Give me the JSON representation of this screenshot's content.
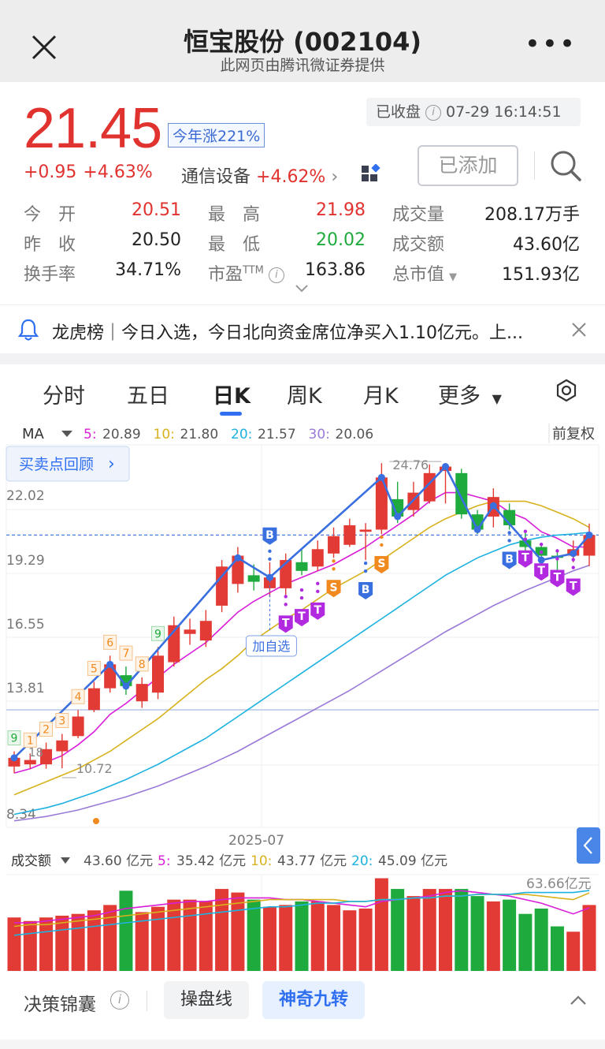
{
  "header": {
    "title": "恒宝股份 (002104)",
    "subtitle": "此网页由腾讯微证券提供",
    "more_label": "•••"
  },
  "quote": {
    "price": "21.45",
    "ytd_badge": "今年涨221%",
    "status": "已收盘",
    "timestamp": "07-29 16:14:51",
    "change": "+0.95",
    "change_pct": "+4.63%",
    "industry": "通信设备",
    "industry_pct": "+4.62%",
    "added_button": "已添加"
  },
  "stats": [
    [
      {
        "label": "今　开",
        "value": "20.51",
        "tone": "red"
      },
      {
        "label": "最　高",
        "value": "21.98",
        "tone": "red"
      },
      {
        "label": "成交量",
        "value": "208.17万手",
        "tone": "plain"
      }
    ],
    [
      {
        "label": "昨　收",
        "value": "20.50",
        "tone": "plain"
      },
      {
        "label": "最　低",
        "value": "20.02",
        "tone": "green"
      },
      {
        "label": "成交额",
        "value": "43.60亿",
        "tone": "plain"
      }
    ],
    [
      {
        "label": "换手率",
        "value": "34.71%",
        "tone": "plain"
      },
      {
        "label": "市盈TTM",
        "value": "163.86",
        "tone": "plain"
      },
      {
        "label": "总市值",
        "value": "151.93亿",
        "tone": "plain"
      }
    ]
  ],
  "notice": {
    "text": "龙虎榜｜今日入选，今日北向资金席位净买入1.10亿元。上..."
  },
  "tabs": [
    {
      "label": "分时",
      "active": false
    },
    {
      "label": "五日",
      "active": false
    },
    {
      "label": "日K",
      "active": true
    },
    {
      "label": "周K",
      "active": false
    },
    {
      "label": "月K",
      "active": false
    },
    {
      "label": "更多",
      "active": false
    }
  ],
  "ma_legend": {
    "label": "MA",
    "items": [
      {
        "name": "5:",
        "value": "20.89",
        "color": "#d81ed8"
      },
      {
        "name": "10:",
        "value": "21.80",
        "color": "#d8b21e"
      },
      {
        "name": "20:",
        "value": "21.57",
        "color": "#1eb2e0"
      },
      {
        "name": "30:",
        "value": "20.06",
        "color": "#9a7ad8"
      }
    ],
    "adjust": "前复权"
  },
  "review_button": "买卖点回顾",
  "add_watch_label": "加自选",
  "volume_legend": {
    "label": "成交额",
    "items": [
      {
        "name": "",
        "value": "43.60 亿元",
        "color": "#555555"
      },
      {
        "name": "5:",
        "value": "35.42 亿元",
        "color": "#d81ed8"
      },
      {
        "name": "10:",
        "value": "43.77 亿元",
        "color": "#d8b21e"
      },
      {
        "name": "20:",
        "value": "45.09 亿元",
        "color": "#1eb2e0"
      }
    ],
    "max_label": "63.66亿元"
  },
  "chart_data": {
    "type": "candlestick",
    "y_ticks": [
      "22.02",
      "19.29",
      "16.55",
      "13.81",
      "8.34"
    ],
    "x_tick": "2025-07",
    "high_label": "24.76",
    "low_label": "10.72",
    "partial_label": "18",
    "last_price": 21.45,
    "candles": [
      {
        "o": 10.8,
        "c": 11.2,
        "h": 11.5,
        "l": 10.5
      },
      {
        "o": 10.9,
        "c": 11.1,
        "h": 11.4,
        "l": 10.7
      },
      {
        "o": 10.9,
        "c": 11.6,
        "h": 11.9,
        "l": 10.7
      },
      {
        "o": 11.5,
        "c": 12.0,
        "h": 12.3,
        "l": 10.72
      },
      {
        "o": 12.2,
        "c": 13.1,
        "h": 13.4,
        "l": 12.1
      },
      {
        "o": 13.4,
        "c": 14.4,
        "h": 14.7,
        "l": 13.3
      },
      {
        "o": 14.4,
        "c": 15.5,
        "h": 15.9,
        "l": 14.2
      },
      {
        "o": 15.0,
        "c": 14.5,
        "h": 15.4,
        "l": 14.1
      },
      {
        "o": 13.8,
        "c": 14.6,
        "h": 14.9,
        "l": 13.5
      },
      {
        "o": 14.2,
        "c": 15.9,
        "h": 16.3,
        "l": 13.9
      },
      {
        "o": 15.6,
        "c": 17.3,
        "h": 17.7,
        "l": 15.4
      },
      {
        "o": 16.9,
        "c": 17.1,
        "h": 17.6,
        "l": 16.4
      },
      {
        "o": 16.6,
        "c": 17.5,
        "h": 18.0,
        "l": 16.3
      },
      {
        "o": 18.2,
        "c": 20.0,
        "h": 20.3,
        "l": 17.9
      },
      {
        "o": 19.2,
        "c": 20.5,
        "h": 20.9,
        "l": 18.8
      },
      {
        "o": 19.6,
        "c": 19.3,
        "h": 20.1,
        "l": 18.9
      },
      {
        "o": 19.0,
        "c": 19.5,
        "h": 20.2,
        "l": 18.6
      },
      {
        "o": 19.0,
        "c": 20.3,
        "h": 20.6,
        "l": 18.7
      },
      {
        "o": 20.2,
        "c": 19.8,
        "h": 20.8,
        "l": 19.6
      },
      {
        "o": 20.0,
        "c": 20.8,
        "h": 21.2,
        "l": 19.8
      },
      {
        "o": 20.6,
        "c": 21.4,
        "h": 21.8,
        "l": 20.4
      },
      {
        "o": 21.0,
        "c": 21.9,
        "h": 22.2,
        "l": 20.9
      },
      {
        "o": 21.6,
        "c": 21.7,
        "h": 22.0,
        "l": 20.3
      },
      {
        "o": 21.7,
        "c": 24.1,
        "h": 24.76,
        "l": 21.5
      },
      {
        "o": 23.1,
        "c": 22.3,
        "h": 23.9,
        "l": 22.0
      },
      {
        "o": 22.6,
        "c": 23.4,
        "h": 23.9,
        "l": 22.3
      },
      {
        "o": 23.0,
        "c": 24.3,
        "h": 24.7,
        "l": 22.9
      },
      {
        "o": 24.4,
        "c": 24.6,
        "h": 24.7,
        "l": 22.9
      },
      {
        "o": 24.3,
        "c": 22.4,
        "h": 24.5,
        "l": 22.2
      },
      {
        "o": 22.4,
        "c": 21.7,
        "h": 22.6,
        "l": 21.5
      },
      {
        "o": 22.3,
        "c": 23.2,
        "h": 23.6,
        "l": 21.8
      },
      {
        "o": 22.6,
        "c": 21.9,
        "h": 22.9,
        "l": 21.7
      },
      {
        "o": 21.2,
        "c": 20.9,
        "h": 21.6,
        "l": 20.6
      },
      {
        "o": 20.9,
        "c": 20.5,
        "h": 21.1,
        "l": 19.9
      },
      {
        "o": 20.5,
        "c": 20.4,
        "h": 20.8,
        "l": 19.8
      },
      {
        "o": 20.5,
        "c": 20.8,
        "h": 21.2,
        "l": 20.2
      },
      {
        "o": 20.5,
        "c": 21.45,
        "h": 21.98,
        "l": 20.02
      }
    ],
    "nine_turn": [
      {
        "i": 0,
        "label": "9",
        "tone": "green"
      },
      {
        "i": 1,
        "label": "1",
        "tone": "orange"
      },
      {
        "i": 2,
        "label": "2",
        "tone": "orange"
      },
      {
        "i": 3,
        "label": "3",
        "tone": "orange"
      },
      {
        "i": 4,
        "label": "4",
        "tone": "orange"
      },
      {
        "i": 5,
        "label": "5",
        "tone": "orange"
      },
      {
        "i": 6,
        "label": "6",
        "tone": "orange"
      },
      {
        "i": 7,
        "label": "7",
        "tone": "orange"
      },
      {
        "i": 8,
        "label": "8",
        "tone": "orange"
      },
      {
        "i": 9,
        "label": "9",
        "tone": "green"
      }
    ],
    "signals": [
      {
        "i": 16,
        "label": "B",
        "kind": "B",
        "pos": "above"
      },
      {
        "i": 17,
        "label": "T",
        "kind": "T",
        "pos": "below"
      },
      {
        "i": 18,
        "label": "T",
        "kind": "T",
        "pos": "below"
      },
      {
        "i": 19,
        "label": "T",
        "kind": "T",
        "pos": "below"
      },
      {
        "i": 20,
        "label": "S",
        "kind": "S",
        "pos": "below"
      },
      {
        "i": 22,
        "label": "B",
        "kind": "B",
        "pos": "below"
      },
      {
        "i": 23,
        "label": "S",
        "kind": "S",
        "pos": "below"
      },
      {
        "i": 31,
        "label": "B",
        "kind": "B",
        "pos": "below"
      },
      {
        "i": 32,
        "label": "T",
        "kind": "T",
        "pos": "below"
      },
      {
        "i": 33,
        "label": "T",
        "kind": "T",
        "pos": "below"
      },
      {
        "i": 34,
        "label": "T",
        "kind": "T",
        "pos": "below"
      },
      {
        "i": 35,
        "label": "T",
        "kind": "T",
        "pos": "below"
      }
    ],
    "zigzag_points": [
      {
        "i": 0,
        "v": 11.2
      },
      {
        "i": 6,
        "v": 15.5
      },
      {
        "i": 7,
        "v": 14.5
      },
      {
        "i": 14,
        "v": 20.4
      },
      {
        "i": 16,
        "v": 19.5
      },
      {
        "i": 23,
        "v": 24.1
      },
      {
        "i": 24,
        "v": 22.3
      },
      {
        "i": 27,
        "v": 24.6
      },
      {
        "i": 29,
        "v": 21.7
      },
      {
        "i": 30,
        "v": 22.8
      },
      {
        "i": 33,
        "v": 20.3
      },
      {
        "i": 35,
        "v": 20.6
      },
      {
        "i": 36,
        "v": 21.45
      }
    ],
    "ma": {
      "ma5": [
        10.5,
        10.7,
        11.0,
        11.3,
        11.8,
        12.4,
        13.2,
        13.7,
        14.3,
        14.9,
        15.5,
        16.0,
        16.5,
        17.2,
        17.9,
        18.4,
        18.8,
        19.2,
        19.5,
        19.8,
        20.1,
        20.5,
        20.9,
        21.4,
        21.9,
        22.4,
        23.0,
        23.4,
        23.4,
        23.2,
        23.0,
        22.5,
        22.2,
        21.6,
        21.3,
        20.9,
        20.9
      ],
      "ma10": [
        9.5,
        9.8,
        10.1,
        10.4,
        10.7,
        11.1,
        11.5,
        12.0,
        12.5,
        13.0,
        13.6,
        14.2,
        14.8,
        15.3,
        15.9,
        16.6,
        17.1,
        17.6,
        18.0,
        18.5,
        19.0,
        19.4,
        19.8,
        20.3,
        20.8,
        21.3,
        21.8,
        22.2,
        22.5,
        22.8,
        23.0,
        23.0,
        23.0,
        22.8,
        22.5,
        22.2,
        21.8
      ],
      "ma20": [
        8.6,
        8.75,
        8.9,
        9.1,
        9.35,
        9.6,
        9.9,
        10.2,
        10.55,
        10.9,
        11.3,
        11.7,
        12.1,
        12.6,
        13.1,
        13.6,
        14.1,
        14.6,
        15.1,
        15.6,
        16.1,
        16.6,
        17.1,
        17.6,
        18.1,
        18.6,
        19.1,
        19.6,
        20.0,
        20.4,
        20.7,
        21.0,
        21.2,
        21.35,
        21.45,
        21.5,
        21.57
      ],
      "ma30": [
        8.3,
        8.4,
        8.5,
        8.65,
        8.8,
        9.0,
        9.2,
        9.4,
        9.65,
        9.9,
        10.2,
        10.5,
        10.8,
        11.15,
        11.5,
        11.9,
        12.3,
        12.7,
        13.1,
        13.5,
        13.9,
        14.3,
        14.75,
        15.2,
        15.65,
        16.1,
        16.55,
        17.0,
        17.4,
        17.8,
        18.2,
        18.55,
        18.9,
        19.2,
        19.5,
        19.8,
        20.06
      ]
    },
    "volume": {
      "values": [
        30,
        28,
        30,
        31,
        32,
        34,
        37,
        45,
        33,
        36,
        40,
        40,
        39,
        46,
        44,
        40,
        36,
        37,
        39,
        39,
        37,
        34,
        35,
        52,
        46,
        42,
        46,
        46,
        46,
        42,
        39,
        40,
        32,
        35,
        25,
        22,
        37
      ],
      "ma5": [
        27,
        27,
        28,
        29,
        30,
        31,
        33,
        35,
        36,
        37,
        38,
        39,
        39,
        40,
        41,
        41,
        41,
        40,
        40,
        39,
        38,
        37,
        36,
        39,
        40,
        41,
        42,
        44,
        45,
        44,
        43,
        42,
        40,
        38,
        35,
        32,
        35.42
      ],
      "ma10": [
        25,
        26,
        26,
        27,
        28,
        29,
        30,
        31,
        32,
        33,
        34,
        35,
        36,
        37,
        38,
        39,
        40,
        40,
        40,
        40,
        40,
        39,
        39,
        40,
        40,
        41,
        41,
        42,
        42,
        43,
        43,
        43,
        43,
        42,
        41,
        40,
        43.77
      ],
      "ma20": [
        20,
        21,
        22,
        23,
        24,
        25,
        26,
        27,
        28,
        29,
        30,
        31,
        32,
        33,
        34,
        35,
        36,
        36,
        37,
        38,
        38,
        39,
        39,
        40,
        40,
        41,
        41,
        42,
        42,
        43,
        43,
        43,
        44,
        44,
        44,
        44,
        45.09
      ]
    }
  }
}
